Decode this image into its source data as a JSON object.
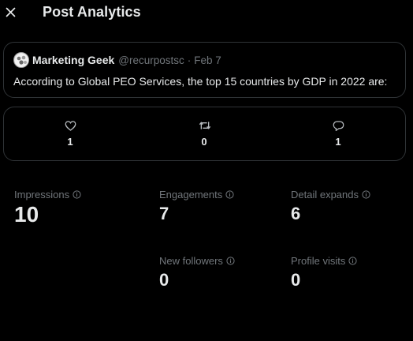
{
  "header": {
    "title": "Post Analytics",
    "close_icon": "close-icon"
  },
  "post": {
    "author_name": "Marketing Geek",
    "author_handle": "@recurpostsc",
    "separator": "·",
    "date": "Feb 7",
    "text": "According to Global PEO Services, the top 15 countries by GDP in 2022 are:"
  },
  "engagement": {
    "likes": "1",
    "retweets": "0",
    "replies": "1",
    "icons": [
      "heart-icon",
      "retweet-icon",
      "reply-icon"
    ]
  },
  "metrics": {
    "impressions": {
      "label": "Impressions",
      "value": "10"
    },
    "engagements": {
      "label": "Engagements",
      "value": "7"
    },
    "detail_expands": {
      "label": "Detail expands",
      "value": "6"
    },
    "new_followers": {
      "label": "New followers",
      "value": "0"
    },
    "profile_visits": {
      "label": "Profile visits",
      "value": "0"
    }
  },
  "colors": {
    "background": "#000000",
    "text_primary": "#e7e9ea",
    "text_secondary": "#71767b",
    "border": "#2f3336"
  }
}
